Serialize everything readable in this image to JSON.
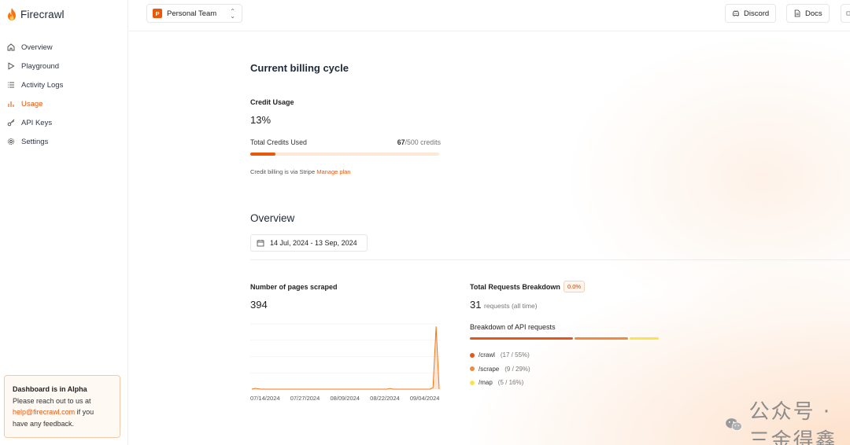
{
  "app": {
    "name": "Firecrawl"
  },
  "sidebar": {
    "items": [
      {
        "label": "Overview",
        "icon": "home-icon"
      },
      {
        "label": "Playground",
        "icon": "play-icon"
      },
      {
        "label": "Activity Logs",
        "icon": "list-icon"
      },
      {
        "label": "Usage",
        "icon": "bar-chart-icon",
        "active": true
      },
      {
        "label": "API Keys",
        "icon": "key-icon"
      },
      {
        "label": "Settings",
        "icon": "gear-icon"
      }
    ],
    "alpha": {
      "title": "Dashboard is in Alpha",
      "line1": "Please reach out to us at",
      "email": "help@firecrawl.com",
      "line2": " if you",
      "line3": "have any feedback."
    }
  },
  "topbar": {
    "team": {
      "avatar": "P",
      "name": "Personal Team"
    },
    "discord": "Discord",
    "docs": "Docs"
  },
  "billing": {
    "title": "Current billing cycle",
    "credit_usage_label": "Credit Usage",
    "credit_percent": "13%",
    "total_credits_label": "Total Credits Used",
    "credits_used": "67",
    "credits_total": "/500 credits",
    "progress": 0.134,
    "stripe_text": "Credit billing is via Stripe",
    "manage_plan": "Manage plan"
  },
  "overview": {
    "title": "Overview",
    "date_range": "14 Jul, 2024 - 13 Sep, 2024",
    "pages_label": "Number of pages scraped",
    "pages_value": "394",
    "requests_label": "Total Requests Breakdown",
    "requests_badge": "0.0%",
    "requests_value": "31",
    "requests_suffix": "requests (all time)",
    "api_breakdown_label": "Breakdown of API requests",
    "breakdown": [
      {
        "name": "/crawl",
        "count": "(17 / 55%)",
        "fraction": 0.55,
        "color": "#e4571b"
      },
      {
        "name": "/scrape",
        "count": "(9 / 29%)",
        "fraction": 0.29,
        "color": "#f08a3e"
      },
      {
        "name": "/map",
        "count": "(5 / 16%)",
        "color": "#fbe34f",
        "fraction": 0.16
      }
    ]
  },
  "chart_data": {
    "type": "area",
    "title": "Number of pages scraped",
    "x_ticks": [
      "07/14/2024",
      "07/27/2024",
      "08/09/2024",
      "08/22/2024",
      "09/04/2024"
    ],
    "x_range": [
      "07/14/2024",
      "09/13/2024"
    ],
    "series": [
      {
        "points": [
          [
            "07/14/2024",
            0
          ],
          [
            "07/15/2024",
            5
          ],
          [
            "07/17/2024",
            0
          ],
          [
            "08/09/2024",
            0
          ],
          [
            "08/10/2024",
            0
          ],
          [
            "08/27/2024",
            0
          ],
          [
            "08/28/2024",
            4
          ],
          [
            "08/29/2024",
            0
          ],
          [
            "09/10/2024",
            0
          ],
          [
            "09/11/2024",
            10
          ],
          [
            "09/12/2024",
            385
          ],
          [
            "09/13/2024",
            0
          ]
        ]
      }
    ],
    "ylim": [
      0,
      400
    ],
    "grid": true
  },
  "watermark": {
    "text": "公众号 · 三金得鑫"
  }
}
